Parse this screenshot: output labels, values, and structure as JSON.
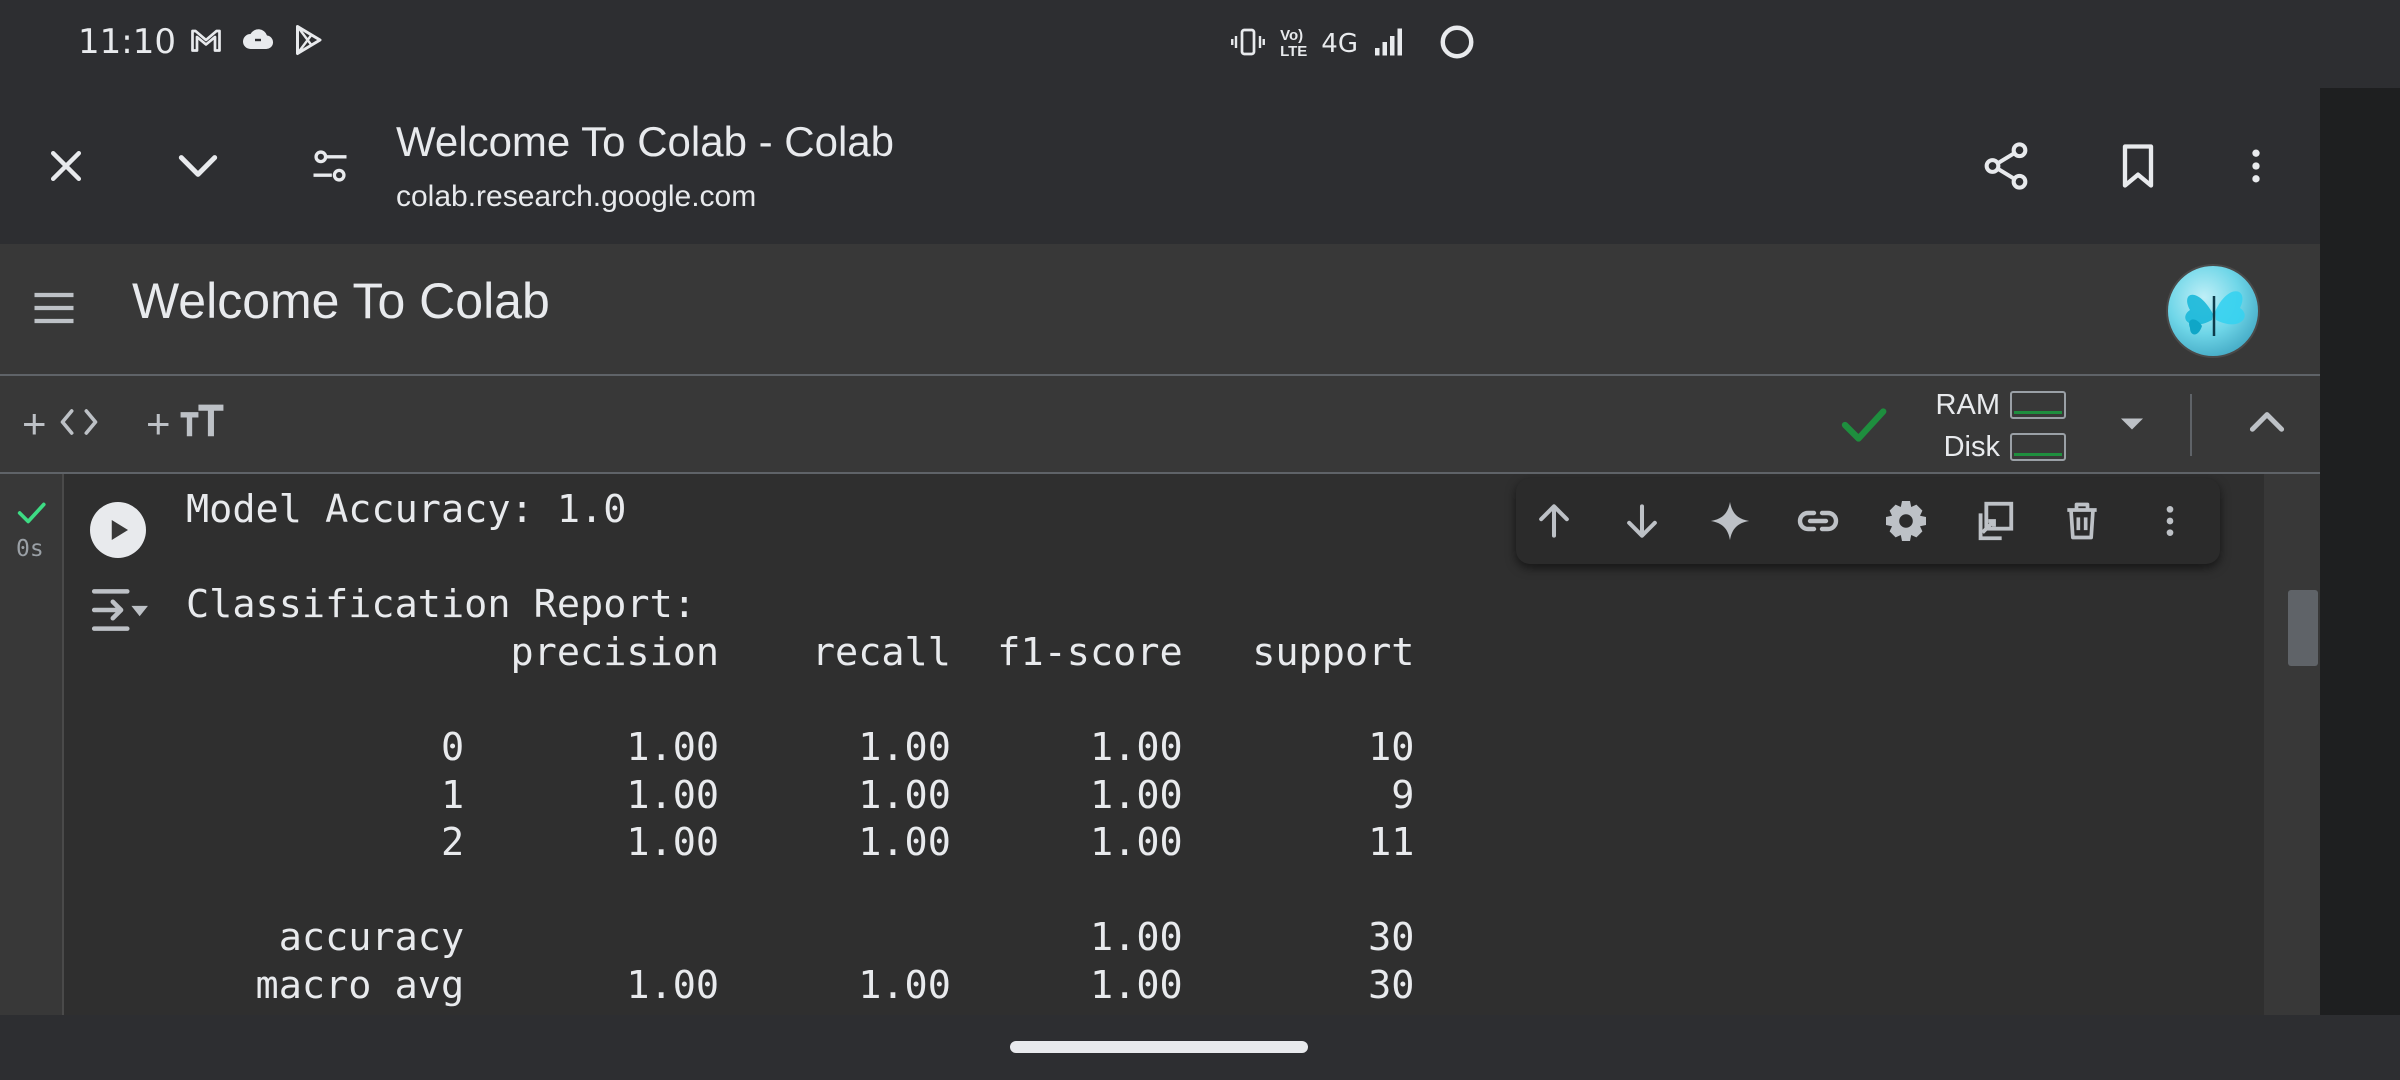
{
  "status_bar": {
    "time": "11:10",
    "icons_left": [
      "gmail-icon",
      "cloud-icon",
      "play-store-icon"
    ],
    "network_label": "4G",
    "volte_label_top": "Vo)",
    "volte_label_bottom": "LTE",
    "icons_right": [
      "vibrate-icon",
      "signal-icon",
      "loading-circle-icon"
    ]
  },
  "browser": {
    "title": "Welcome To Colab - Colab",
    "url": "colab.research.google.com",
    "left_buttons": [
      "close-icon",
      "chevron-down-icon",
      "tune-icon"
    ],
    "right_buttons": [
      "share-icon",
      "bookmark-icon",
      "more-vert-icon"
    ]
  },
  "header": {
    "notebook_title": "Welcome To Colab",
    "avatar": "butterfly avatar"
  },
  "toolbar": {
    "add_code_plus": "+",
    "add_text_plus": "+",
    "ram_label": "RAM",
    "disk_label": "Disk",
    "connected": true
  },
  "cell": {
    "exec_time": "0s",
    "output_lines": [
      "Model Accuracy: 1.0",
      "",
      "Classification Report:",
      "              precision    recall  f1-score   support",
      "",
      "           0       1.00      1.00      1.00        10",
      "           1       1.00      1.00      1.00         9",
      "           2       1.00      1.00      1.00        11",
      "",
      "    accuracy                           1.00        30",
      "   macro avg       1.00      1.00      1.00        30"
    ],
    "tools": [
      "arrow-up-icon",
      "arrow-down-icon",
      "sparkle-icon",
      "link-icon",
      "gear-icon",
      "mirror-cell-icon",
      "trash-icon",
      "more-vert-icon"
    ]
  },
  "colors": {
    "check_green": "#1e8e3e",
    "status_green": "#3ddc84",
    "background": "#2d2e31",
    "panel": "#383838"
  }
}
